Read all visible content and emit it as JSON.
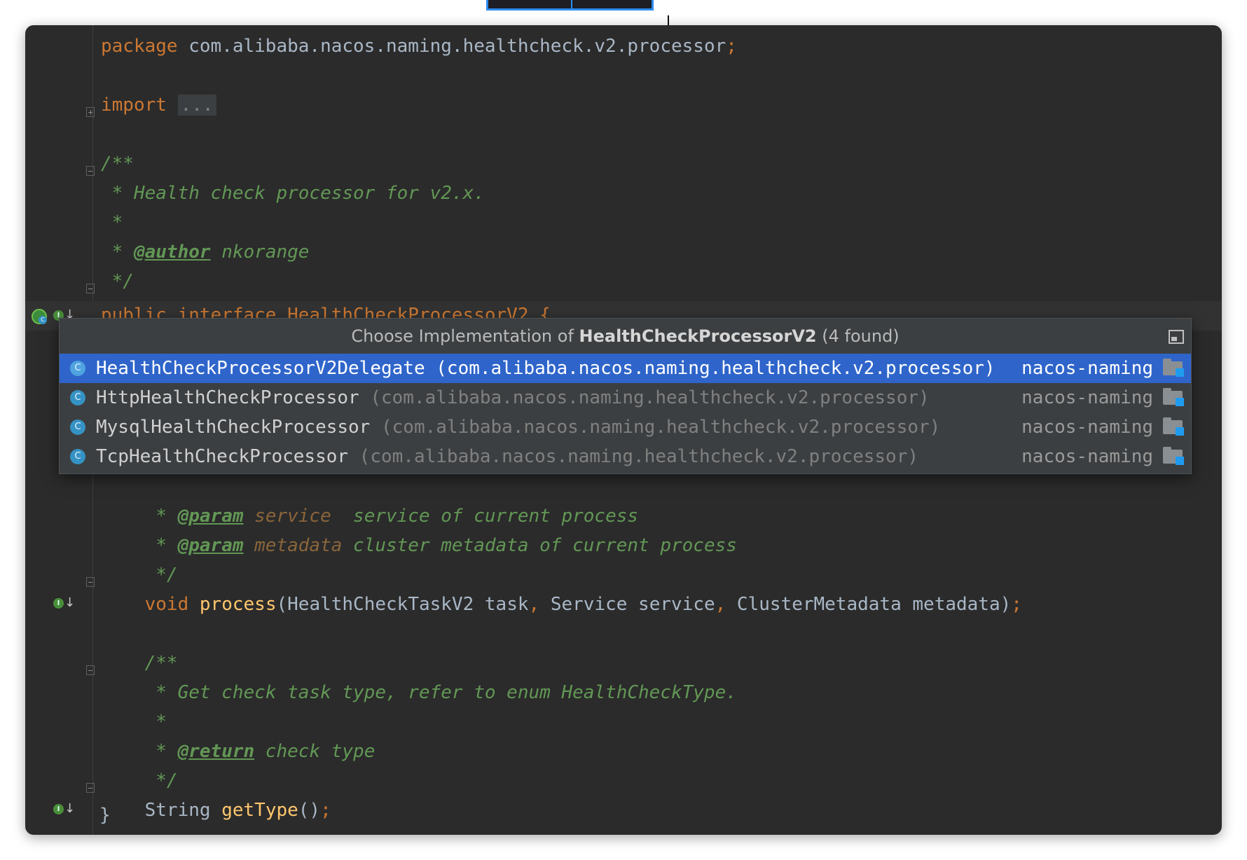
{
  "code": {
    "package_kw": "package",
    "package_name": " com.alibaba.nacos.naming.healthcheck.v2.processor",
    "semicolon": ";",
    "import_kw": "import",
    "import_fold": "...",
    "doc_open": "/**",
    "doc_desc": " * Health check processor for v2.x.",
    "doc_star": " *",
    "doc_author_prefix": " * ",
    "doc_author_tag": "@author",
    "doc_author_value": " nkorange",
    "doc_close": " */",
    "interface_line": "public interface HealthCheckProcessorV2 {",
    "param1_prefix": "     * ",
    "param1_tag": "@param",
    "param1_name": " service",
    "param1_desc": "  service of current process",
    "param2_prefix": "     * ",
    "param2_tag": "@param",
    "param2_name": " metadata",
    "param2_desc": " cluster metadata of current process",
    "doc2_close": "     */",
    "process_indent": "    ",
    "process_kw": "void",
    "process_fn": " process",
    "process_open": "(HealthCheckTaskV2 task",
    "comma1": ",",
    "process_arg2": " Service service",
    "comma2": ",",
    "process_arg3": " ClusterMetadata metadata)",
    "process_semi": ";",
    "doc3_open": "    /**",
    "doc3_desc": "     * Get check task type, refer to enum HealthCheckType.",
    "doc3_star": "     *",
    "return_prefix": "     * ",
    "return_tag": "@return",
    "return_desc": " check type",
    "doc3_close": "     */",
    "gettype_indent": "    String",
    "gettype_fn": " getType",
    "gettype_paren": "()",
    "gettype_semi": ";",
    "close_brace": "}"
  },
  "popup": {
    "title_prefix": "Choose Implementation of ",
    "title_name": "HealthCheckProcessorV2",
    "title_count": " (4 found)",
    "items": [
      {
        "name": "HealthCheckProcessorV2Delegate",
        "package": " (com.alibaba.nacos.naming.healthcheck.v2.processor)",
        "module": "nacos-naming"
      },
      {
        "name": "HttpHealthCheckProcessor",
        "package": " (com.alibaba.nacos.naming.healthcheck.v2.processor)",
        "module": "nacos-naming"
      },
      {
        "name": "MysqlHealthCheckProcessor",
        "package": " (com.alibaba.nacos.naming.healthcheck.v2.processor)",
        "module": "nacos-naming"
      },
      {
        "name": "TcpHealthCheckProcessor",
        "package": " (com.alibaba.nacos.naming.healthcheck.v2.processor)",
        "module": "nacos-naming"
      }
    ],
    "class_icon_letter": "C"
  },
  "icons": {
    "implemented_badge": "I",
    "interface_badge": "C"
  },
  "colors": {
    "editor_bg": "#2b2b2b",
    "keyword": "#cc7832",
    "function": "#ffc66d",
    "comment": "#629755",
    "selection": "#2f65ca"
  }
}
